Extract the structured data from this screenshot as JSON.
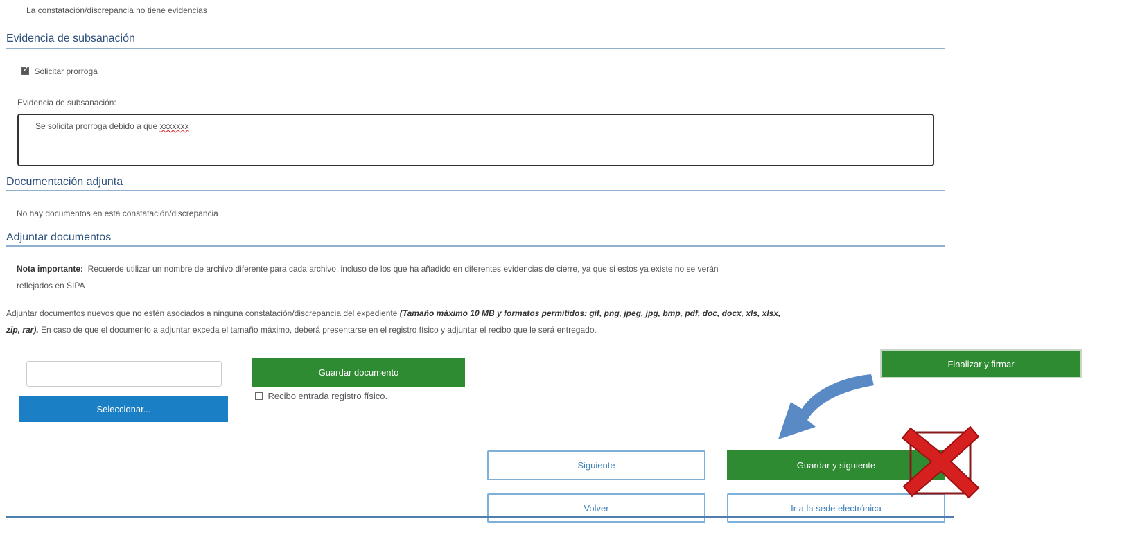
{
  "no_evidence_text": "La constatación/discrepancia no tiene evidencias",
  "evidence_section": {
    "title": "Evidencia de subsanación",
    "checkbox_label": "Solicitar prorroga",
    "checkbox_checked": true,
    "field_label": "Evidencia de subsanación:",
    "field_value_plain": "Se solicita prorroga debido a que ",
    "field_value_misspelled": "xxxxxxx"
  },
  "docs_section": {
    "title": "Documentación adjunta",
    "empty_text": "No hay documentos en esta constatación/discrepancia"
  },
  "attach_section": {
    "title": "Adjuntar documentos",
    "note_label": "Nota importante:",
    "note_line1": "Recuerde utilizar un nombre de archivo diferente para cada archivo, incluso de los que ha añadido en diferentes evidencias de cierre, ya que si estos ya existe no se verán",
    "note_line2": "reflejados en SIPA",
    "info_line1_plain": "Adjuntar documentos nuevos que no estén asociados a ninguna constatación/discrepancia del expediente ",
    "info_line1_bold": "(Tamaño máximo 10 MB y formatos permitidos: gif, png, jpeg, jpg, bmp, pdf, doc, docx, xls, xlsx,",
    "info_line2_bold": "zip, rar).",
    "info_line2_plain": " En caso de que el documento a adjuntar exceda el tamaño máximo, deberá presentarse en el registro físico y adjuntar el recibo que le será entregado.",
    "file_input_value": "",
    "select_button": "Seleccionar...",
    "save_doc_button": "Guardar documento",
    "receipt_label": "Recibo entrada registro físico.",
    "receipt_checked": false
  },
  "actions": {
    "finalize_sign": "Finalizar y firmar",
    "next": "Siguiente",
    "save_next": "Guardar y siguiente",
    "back": "Volver",
    "go_sede": "Ir a la sede electrónica"
  },
  "colors": {
    "green": "#2e8b32",
    "blue": "#1a7fc4",
    "arrow": "#5a8ac6",
    "cross": "#d61f1f",
    "section_title": "#2c4f7c"
  },
  "icons": {
    "arrow": "curved-arrow-icon",
    "cross": "red-cross-icon"
  }
}
